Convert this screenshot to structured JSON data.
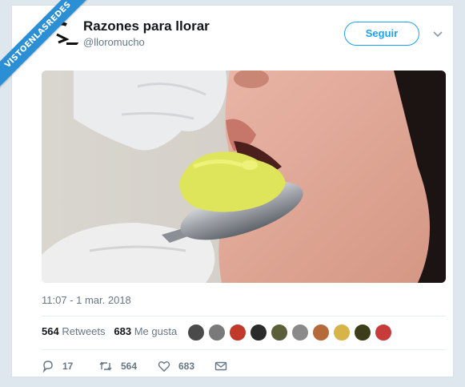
{
  "watermark": {
    "text": "VISTOENLASREDES"
  },
  "tweet": {
    "author_name": "Razones para llorar",
    "author_handle": "@lloromucho",
    "follow_label": "Seguir",
    "timestamp": "11:07 - 1 mar. 2018",
    "stats": {
      "retweets_count": "564",
      "retweets_label": "Retweets",
      "likes_count": "683",
      "likes_label": "Me gusta"
    },
    "actions": {
      "reply_count": "17",
      "retweet_count": "564",
      "like_count": "683"
    },
    "likers": [
      {
        "color": "#4a4a4a",
        "icon": "avatar-1"
      },
      {
        "color": "#7a7a7a",
        "icon": "avatar-2"
      },
      {
        "color": "#c0392b",
        "icon": "avatar-3"
      },
      {
        "color": "#2b2b2b",
        "icon": "avatar-4"
      },
      {
        "color": "#5b5f3a",
        "icon": "avatar-5"
      },
      {
        "color": "#8a8a8a",
        "icon": "avatar-6"
      },
      {
        "color": "#b56a3a",
        "icon": "avatar-7"
      },
      {
        "color": "#d7b44a",
        "icon": "avatar-8"
      },
      {
        "color": "#3d3d1a",
        "icon": "avatar-9"
      },
      {
        "color": "#c83b3b",
        "icon": "avatar-10"
      }
    ]
  },
  "colors": {
    "accent": "#1da1f2",
    "muted": "#657786",
    "text": "#14171a"
  }
}
